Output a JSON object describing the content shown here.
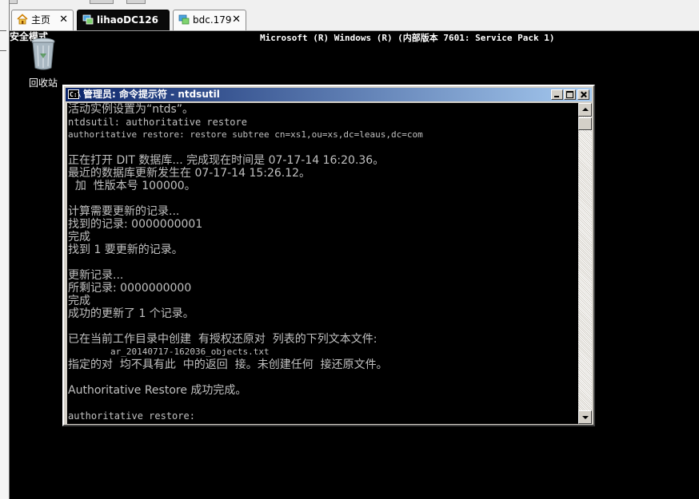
{
  "host": {
    "tabs": [
      {
        "label": "主页",
        "icon": "home-icon"
      },
      {
        "label": "lihaoDC126",
        "icon": "server-icon"
      },
      {
        "label": "bdc.179",
        "icon": "remote-icon"
      }
    ],
    "close_glyph": "✕"
  },
  "desktop": {
    "safe_mode": "安全模式",
    "os_banner": "Microsoft (R) Windows (R) (内部版本 7601: Service Pack 1)",
    "recycle_bin": "回收站"
  },
  "cmd": {
    "title": "管理员: 命令提示符 - ntdsutil",
    "icon_text": "C:\\",
    "lines": [
      "活动实例设置为“ntds”。",
      "ntdsutil: authoritative restore",
      "authoritative restore: restore subtree cn=xs1,ou=xs,dc=leaus,dc=com",
      "",
      "正在打开 DIT 数据库... 完成现在时间是 07-17-14 16:20.36。",
      "最近的数据库更新发生在 07-17-14 15:26.12。",
      "  加  性版本号 100000。",
      "",
      "计算需要更新的记录...",
      "找到的记录: 0000000001",
      "完成",
      "找到 1 要更新的记录。",
      "",
      "更新记录...",
      "所剩记录: 0000000000",
      "完成",
      "成功的更新了 1 个记录。",
      "",
      "已在当前工作目录中创建  有授权还原对  列表的下列文本文件:",
      "        ar_20140717-162036_objects.txt",
      "指定的对  均不具有此  中的返回  接。未创建任何  接还原文件。",
      "",
      "Authoritative Restore 成功完成。",
      "",
      "authoritative restore:"
    ]
  },
  "colors": {
    "console_bg": "#000000",
    "console_text": "#c0c0c0",
    "titlebar_start": "#0a246a",
    "titlebar_end": "#a6caf0"
  }
}
